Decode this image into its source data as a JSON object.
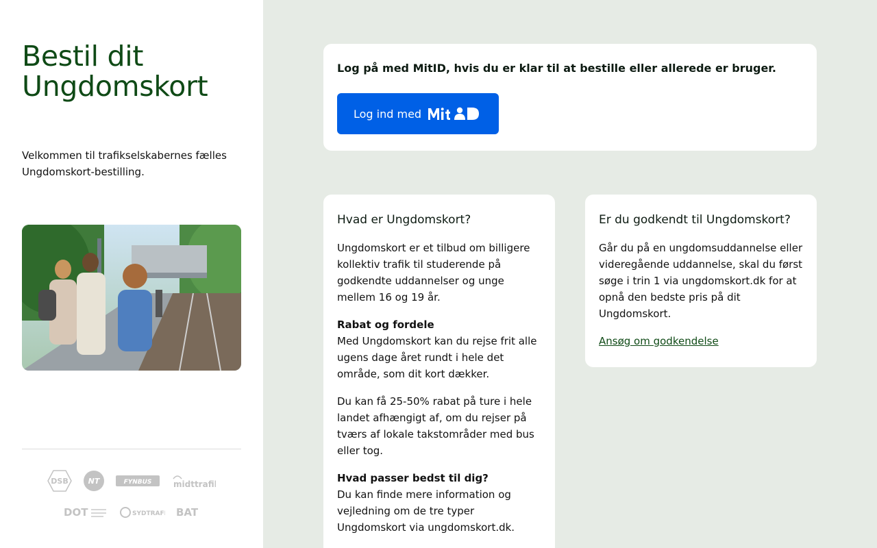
{
  "sidebar": {
    "title_line1": "Bestil dit",
    "title_line2": "Ungdomskort",
    "intro": "Velkommen til trafikselskabernes fælles Ungdomskort-bestilling.",
    "logos_row1": [
      "DSB",
      "NT",
      "FYNBUS",
      "midttrafik"
    ],
    "logos_row2": [
      "DOT",
      "SYDTRAFIK",
      "BAT"
    ]
  },
  "login_card": {
    "lead": "Log på med MitID, hvis du er klar til at bestille eller allerede er bruger.",
    "button_label": "Log ind med",
    "button_brand": "MitID"
  },
  "info_card": {
    "heading": "Hvad er Ungdomskort?",
    "p1": "Ungdomskort er et tilbud om billigere kollektiv trafik til studerende på godkendte uddannelser og unge mellem 16 og 19 år.",
    "p2_title": "Rabat og fordele",
    "p2_body": "Med Ungdomskort kan du rejse frit alle ugens dage året rundt i hele det område, som dit kort dækker.",
    "p3": "Du kan få 25-50% rabat på ture i hele landet afhængigt af, om du rejser på tværs af lokale takstområder med bus eller tog.",
    "p4_title": "Hvad passer bedst til dig?",
    "p4_body": "Du kan finde mere information og vejledning om de tre typer Ungdomskort via ungdomskort.dk."
  },
  "approved_card": {
    "heading": "Er du godkendt til Ungdomskort?",
    "body": "Går du på en ungdomsuddannelse eller videregående uddannelse, skal du først søge i trin 1 via ungdomskort.dk for at opnå den bedste pris på dit Ungdomskort.",
    "link": "Ansøg om godkendelse"
  },
  "colors": {
    "brand_green": "#0f4a16",
    "mitid_blue": "#0060e6",
    "page_bg": "#e6ebe5"
  }
}
